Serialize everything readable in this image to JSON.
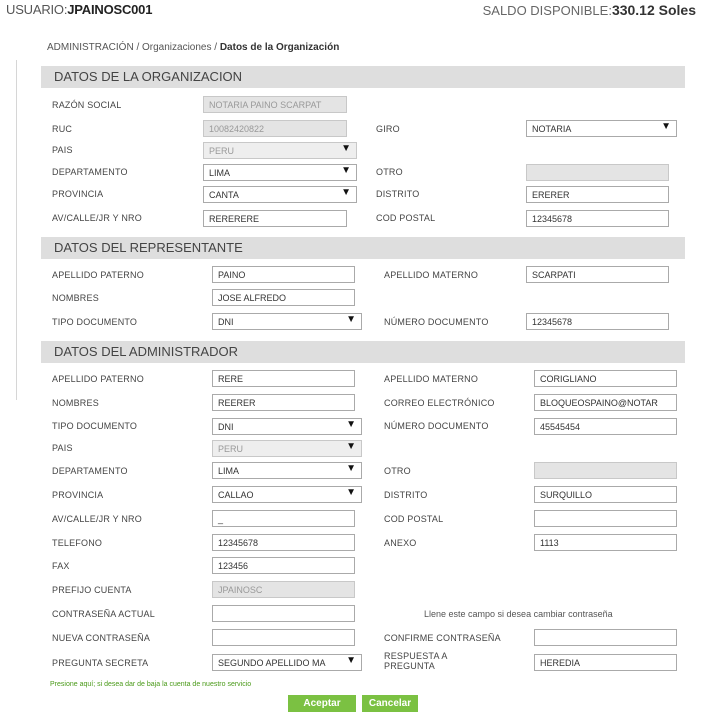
{
  "header": {
    "user_label": "USUARIO:",
    "user_name": "JPAINOSC001",
    "saldo_label": "SALDO DISPONIBLE:",
    "saldo_value": "330.12 Soles"
  },
  "breadcrumb": {
    "level1": "ADMINISTRACIÓN / Organizaciones / ",
    "current": "Datos de la Organización"
  },
  "org": {
    "title": "DATOS DE LA ORGANIZACION",
    "razon_label": "RAZÓN SOCIAL",
    "razon_value": "NOTARIA PAINO SCARPAT",
    "ruc_label": "RUC",
    "ruc_value": "10082420822",
    "giro_label": "GIRO",
    "giro_value": "NOTARIA",
    "pais_label": "PAIS",
    "pais_value": "PERU",
    "depto_label": "DEPARTAMENTO",
    "depto_value": "LIMA",
    "otro_label": "OTRO",
    "otro_value": "",
    "prov_label": "PROVINCIA",
    "prov_value": "CANTA",
    "dist_label": "DISTRITO",
    "dist_value": "ERERER",
    "dir_label": "AV/CALLE/JR Y NRO",
    "dir_value": "RERERERE",
    "cp_label": "COD POSTAL",
    "cp_value": "12345678"
  },
  "rep": {
    "title": "DATOS DEL REPRESENTANTE",
    "ap_pat_label": "APELLIDO PATERNO",
    "ap_pat_value": "PAINO",
    "ap_mat_label": "APELLIDO MATERNO",
    "ap_mat_value": "SCARPATI",
    "nombres_label": "NOMBRES",
    "nombres_value": "JOSE ALFREDO",
    "tipo_doc_label": "TIPO DOCUMENTO",
    "tipo_doc_value": "DNI",
    "num_doc_label": "NÚMERO DOCUMENTO",
    "num_doc_value": "12345678"
  },
  "adm": {
    "title": "DATOS DEL ADMINISTRADOR",
    "ap_pat_label": "APELLIDO PATERNO",
    "ap_pat_value": "RERE",
    "ap_mat_label": "APELLIDO MATERNO",
    "ap_mat_value": "CORIGLIANO",
    "nombres_label": "NOMBRES",
    "nombres_value": "REERER",
    "correo_label": "CORREO ELECTRÓNICO",
    "correo_value": "BLOQUEOSPAINO@NOTAR",
    "tipo_doc_label": "TIPO DOCUMENTO",
    "tipo_doc_value": "DNI",
    "num_doc_label": "NÚMERO DOCUMENTO",
    "num_doc_value": "45545454",
    "pais_label": "PAIS",
    "pais_value": "PERU",
    "depto_label": "DEPARTAMENTO",
    "depto_value": "LIMA",
    "otro_label": "OTRO",
    "otro_value": "",
    "prov_label": "PROVINCIA",
    "prov_value": "CALLAO",
    "dist_label": "DISTRITO",
    "dist_value": "SURQUILLO",
    "dir_label": "AV/CALLE/JR Y NRO",
    "dir_value": "_",
    "cp_label": "COD POSTAL",
    "cp_value": "",
    "tel_label": "TELEFONO",
    "tel_value": "12345678",
    "anexo_label": "ANEXO",
    "anexo_value": "1113",
    "fax_label": "FAX",
    "fax_value": "123456",
    "prefijo_label": "PREFIJO CUENTA",
    "prefijo_value": "JPAINOSC",
    "pwd_actual_label": "CONTRASEÑA ACTUAL",
    "pwd_actual_value": "",
    "pwd_hint": "Llene este campo si desea cambiar contraseña",
    "pwd_new_label": "NUEVA CONTRASEÑA",
    "pwd_new_value": "",
    "pwd_confirm_label": "CONFIRME CONTRASEÑA",
    "pwd_confirm_value": "",
    "pregunta_label": "PREGUNTA SECRETA",
    "pregunta_value": "SEGUNDO APELLIDO MA",
    "respuesta_label_1": "RESPUESTA A",
    "respuesta_label_2": "PREGUNTA",
    "respuesta_value": "HEREDIA"
  },
  "footer": {
    "baja_link": "Presione aquí; si desea dar de baja la cuenta de nuestro servicio",
    "accept": "Aceptar",
    "cancel": "Cancelar"
  },
  "icons": {
    "dropdown": "dropdown-arrow-icon"
  },
  "colors": {
    "accent": "#7bc142",
    "section_bg": "#dedede"
  }
}
